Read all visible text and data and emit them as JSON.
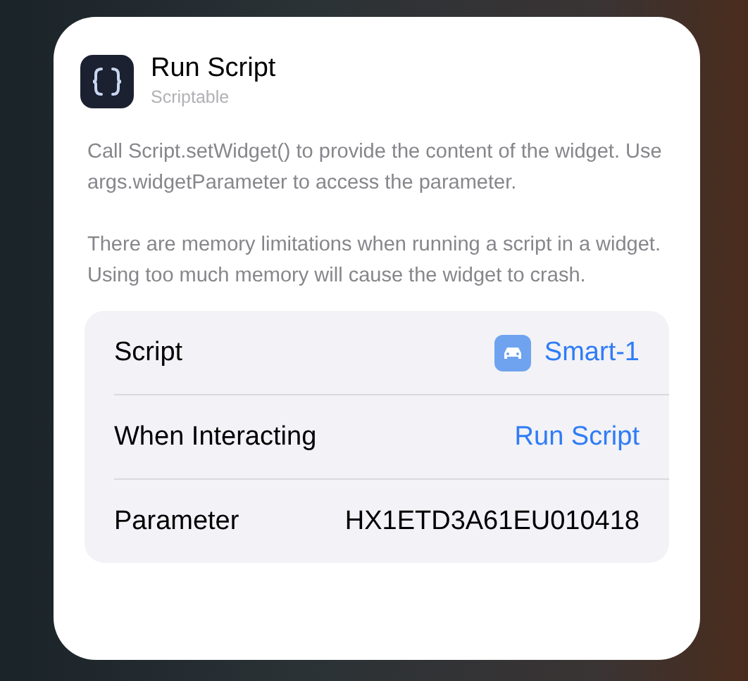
{
  "header": {
    "title": "Run Script",
    "subtitle": "Scriptable"
  },
  "description": [
    "Call Script.setWidget() to provide the content of the widget. Use args.widgetParameter to access the parameter.",
    "There are memory limitations when running a script in a widget. Using too much memory will cause the widget to crash."
  ],
  "settings": [
    {
      "kind": "script",
      "label": "Script",
      "value": "Smart-1"
    },
    {
      "kind": "link",
      "label": "When Interacting",
      "value": "Run Script"
    },
    {
      "kind": "text",
      "label": "Parameter",
      "value": "HX1ETD3A61EU010418"
    }
  ]
}
